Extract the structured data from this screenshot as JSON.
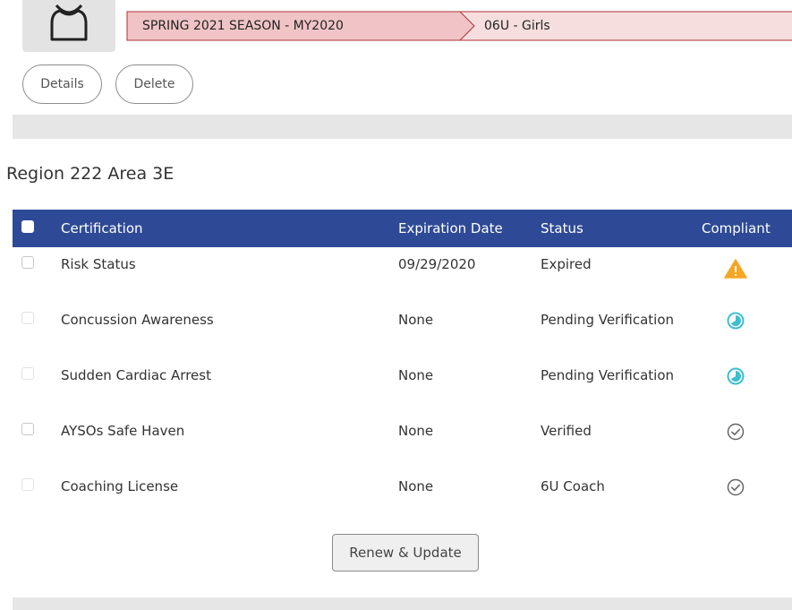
{
  "breadcrumb": {
    "season": "SPRING 2021 SEASON - MY2020",
    "division": "06U - Girls"
  },
  "actions": {
    "details_label": "Details",
    "delete_label": "Delete"
  },
  "region": {
    "title": "Region 222 Area 3E"
  },
  "table": {
    "headers": {
      "certification": "Certification",
      "expiration": "Expiration Date",
      "status": "Status",
      "compliant": "Compliant"
    },
    "rows": [
      {
        "certification": "Risk Status",
        "expiration": "09/29/2020",
        "status": "Expired",
        "compliant_icon": "warning-icon"
      },
      {
        "certification": "Concussion Awareness",
        "expiration": "None",
        "status": "Pending Verification",
        "compliant_icon": "pending-clock-icon"
      },
      {
        "certification": "Sudden Cardiac Arrest",
        "expiration": "None",
        "status": "Pending Verification",
        "compliant_icon": "pending-clock-icon"
      },
      {
        "certification": "AYSOs Safe Haven",
        "expiration": "None",
        "status": "Verified",
        "compliant_icon": "check-circle-icon"
      },
      {
        "certification": "Coaching License",
        "expiration": "None",
        "status": "6U Coach",
        "compliant_icon": "check-circle-icon"
      }
    ]
  },
  "renew_button": {
    "label": "Renew & Update"
  },
  "colors": {
    "header_bg": "#2e4a96",
    "breadcrumb_fill": "#f2cfd0",
    "breadcrumb_border": "#b0303a",
    "warning": "#f5a623",
    "pending": "#3cbfd0",
    "verified": "#666666"
  }
}
